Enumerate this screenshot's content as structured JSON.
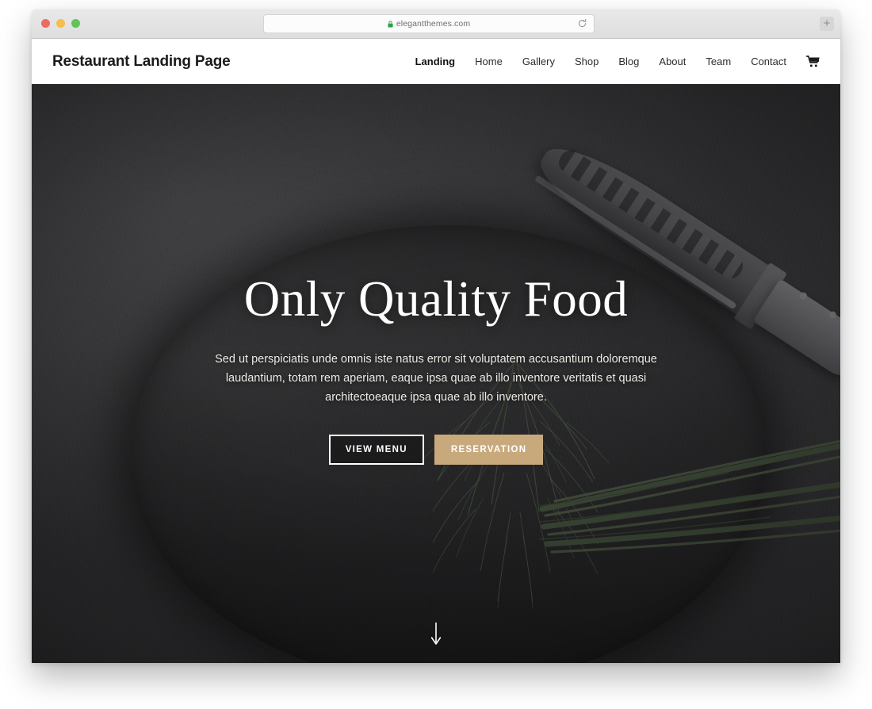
{
  "browser": {
    "url": "elegantthemes.com",
    "lock_icon": "lock-icon",
    "reload_icon": "reload-icon",
    "new_tab_label": "+",
    "traffic_lights": [
      "close",
      "minimize",
      "maximize"
    ]
  },
  "header": {
    "logo": "Restaurant Landing Page",
    "nav": [
      {
        "label": "Landing",
        "active": true
      },
      {
        "label": "Home",
        "active": false
      },
      {
        "label": "Gallery",
        "active": false
      },
      {
        "label": "Shop",
        "active": false
      },
      {
        "label": "Blog",
        "active": false
      },
      {
        "label": "About",
        "active": false
      },
      {
        "label": "Team",
        "active": false
      },
      {
        "label": "Contact",
        "active": false
      }
    ],
    "cart_icon": "shopping-cart-icon"
  },
  "hero": {
    "title": "Only Quality Food",
    "subtitle": "Sed ut perspiciatis unde omnis iste natus error sit voluptatem accusantium doloremque laudantium, totam rem aperiam, eaque ipsa quae ab illo inventore veritatis et quasi architectoeaque ipsa quae ab illo inventore.",
    "primary_button": "VIEW MENU",
    "secondary_button": "RESERVATION",
    "scroll_icon": "arrow-down-icon",
    "accent_color": "#c8a97c",
    "text_color": "#ffffff"
  }
}
